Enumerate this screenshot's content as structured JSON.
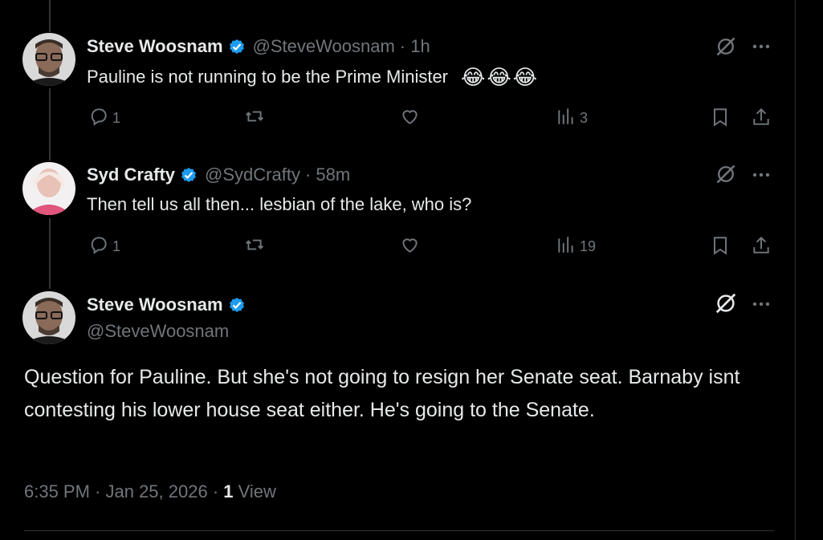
{
  "tweets": [
    {
      "name": "Steve Woosnam",
      "handle": "@SteveWoosnam",
      "time": "· 1h",
      "text": "Pauline is not running to be the Prime Minister",
      "emojis": [
        "😂",
        "😂",
        "😂"
      ],
      "replies": "1",
      "views": "3"
    },
    {
      "name": "Syd Crafty",
      "handle": "@SydCrafty",
      "time": "· 58m",
      "text": "Then tell us all then... lesbian of the lake, who is?",
      "replies": "1",
      "views": "19"
    }
  ],
  "main_tweet": {
    "name": "Steve Woosnam",
    "handle": "@SteveWoosnam",
    "text": "Question for Pauline. But she's not going to resign her Senate seat. Barnaby isnt contesting his lower house seat either. He's going to the Senate.",
    "timestamp": "6:35 PM · Jan 25, 2026 · ",
    "views_count": "1",
    "views_label": "View"
  },
  "colors": {
    "background": "#000000",
    "text": "#e7e9ea",
    "muted": "#71767b",
    "verified": "#1d9bf0"
  },
  "icons": [
    "reply-icon",
    "retweet-icon",
    "like-icon",
    "views-icon",
    "bookmark-icon",
    "share-icon",
    "grok-icon",
    "more-icon",
    "verified-icon"
  ]
}
